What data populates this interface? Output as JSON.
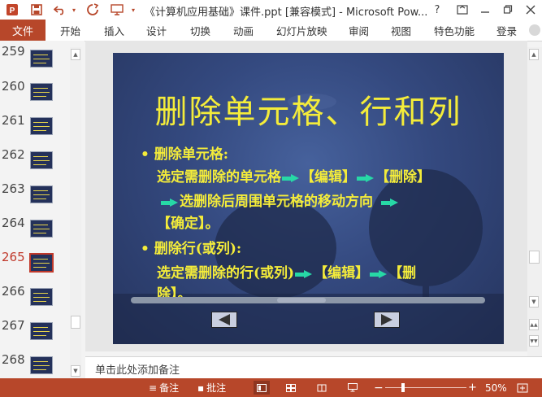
{
  "window": {
    "title": "《计算机应用基础》课件.ppt [兼容模式] - Microsoft Pow...",
    "app_icon": "powerpoint-icon",
    "help": "?",
    "quick_access_icons": [
      "save-icon",
      "undo-icon",
      "redo-icon",
      "slideshow-from-start-icon",
      "customize-icon"
    ]
  },
  "ribbon": {
    "file_tab": "文件",
    "tabs": [
      "开始",
      "插入",
      "设计",
      "切换",
      "动画",
      "幻灯片放映",
      "审阅",
      "视图",
      "特色功能"
    ],
    "signin": "登录"
  },
  "thumbnails": {
    "numbers": [
      "259",
      "260",
      "261",
      "262",
      "263",
      "264",
      "265",
      "266",
      "267",
      "268"
    ],
    "selected": "265"
  },
  "slide": {
    "title": "删除单元格、行和列",
    "bullet1_heading": "• 删除单元格:",
    "bullet1_line1_a": "选定需删除的单元格",
    "bullet1_line1_b": "【编辑】",
    "bullet1_line1_c": "【删除】",
    "bullet1_line2": "选删除后周围单元格的移动方向",
    "bullet1_line3": "【确定】。",
    "bullet2_heading": "• 删除行(或列):",
    "bullet2_line1_a": "选定需删除的行(或列)",
    "bullet2_line1_b": "【编辑】",
    "bullet2_line1_c": "【删",
    "bullet2_line2": "除】。"
  },
  "notes": {
    "placeholder": "单击此处添加备注"
  },
  "statusbar": {
    "notes_label": "备注",
    "comments_label": "批注",
    "zoom": "50%",
    "zoom_fraction": 0.5
  },
  "colors": {
    "accent": "#b7472a",
    "slide_text": "#f4ec3a",
    "arrow": "#27d8a6",
    "selected_thumb": "#c0392b"
  }
}
